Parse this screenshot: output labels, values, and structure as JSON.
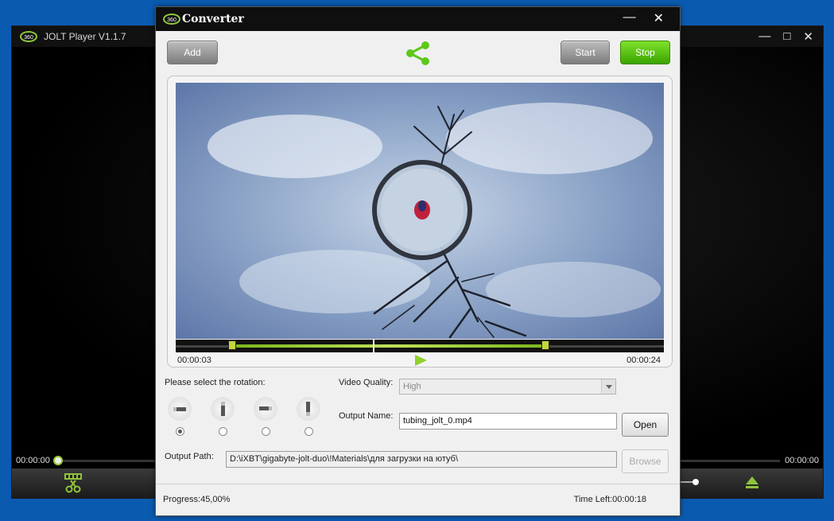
{
  "player": {
    "title": "JOLT Player V1.1.7",
    "time_left": "00:00:00",
    "time_right": "00:00:00",
    "icons": {
      "logo": "jolt-360-logo",
      "scissors": "scissors-icon",
      "eject": "eject-icon"
    }
  },
  "converter": {
    "title": "Converter",
    "buttons": {
      "add": "Add",
      "start": "Start",
      "stop": "Stop",
      "open": "Open",
      "browse": "Browse"
    },
    "preview": {
      "time_start": "00:00:03",
      "time_end": "00:00:24"
    },
    "rotation": {
      "label": "Please select the rotation:",
      "options": [
        {
          "icon": "rotate-0-icon",
          "checked": true
        },
        {
          "icon": "rotate-90-icon",
          "checked": false
        },
        {
          "icon": "rotate-180-icon",
          "checked": false
        },
        {
          "icon": "rotate-270-icon",
          "checked": false
        }
      ]
    },
    "video_quality": {
      "label": "Video Quality:",
      "value": "High"
    },
    "output_name": {
      "label": "Output Name:",
      "value": "tubing_jolt_0.mp4"
    },
    "output_path": {
      "label": "Output Path:",
      "value": "D:\\iXBT\\gigabyte-jolt-duo\\!Materials\\для загрузки на ютуб\\"
    },
    "status": {
      "progress": "Progress:45,00%",
      "time_left": "Time Left:00:00:18"
    },
    "colors": {
      "accent_green": "#5cc81a",
      "titlebar": "#0f0f0f",
      "background": "#f0f0f0"
    }
  }
}
